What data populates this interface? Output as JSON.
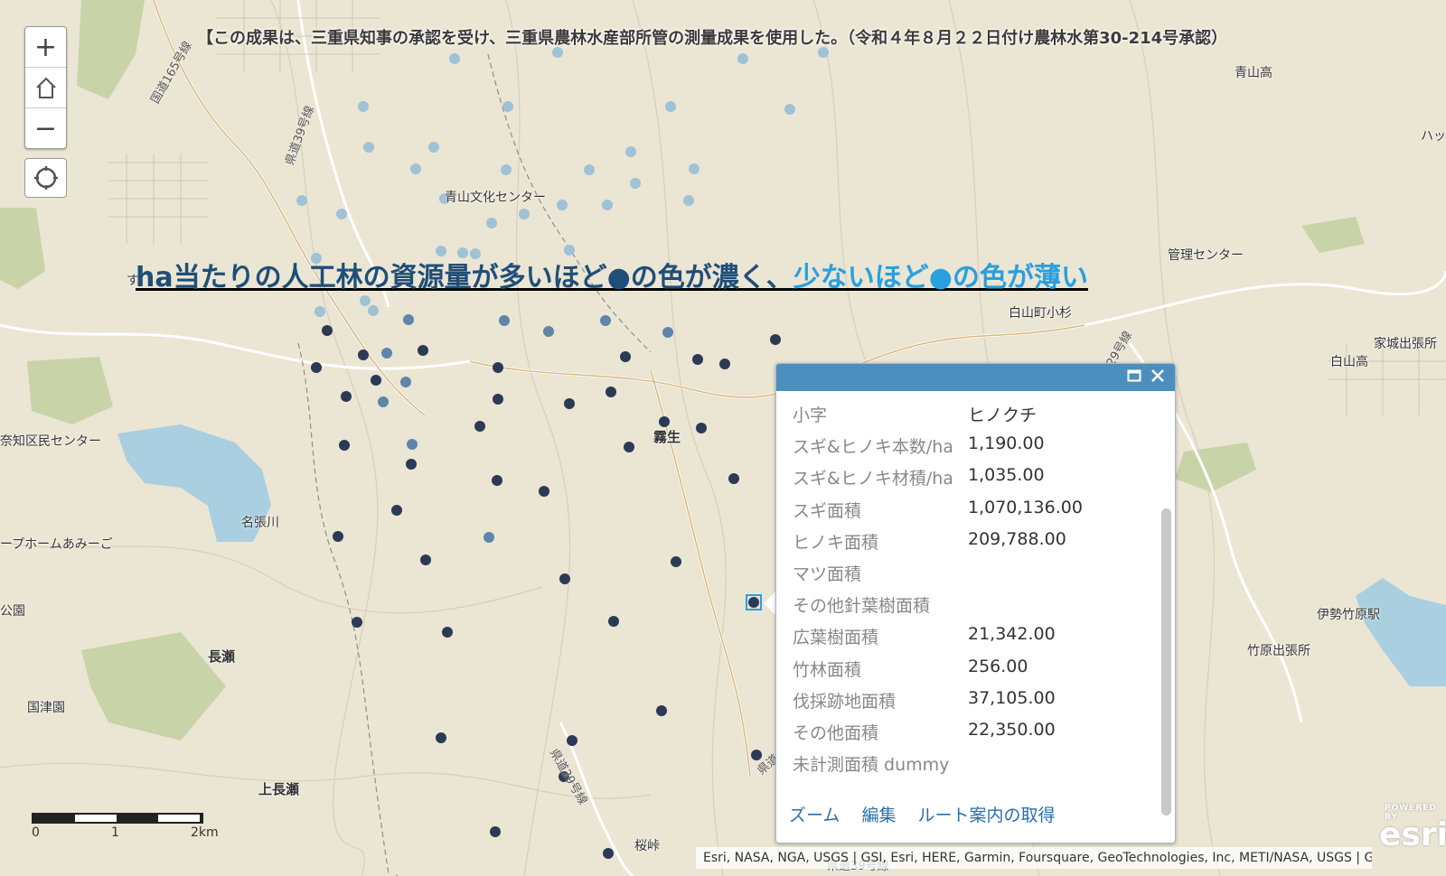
{
  "map": {
    "notice": "【この成果は、三重県知事の承認を受け、三重県農林水産部所管の測量成果を使用した。（令和４年８月２２日付け農林水第30-214号承認）",
    "legend_dark": "ha当たりの人工林の資源量が多いほど●の色が濃く、",
    "legend_light": "少ないほど●の色が薄い",
    "places": {
      "aoyama_bunka": "青山文化センター",
      "aoyama_ko": "青山高",
      "kanri": "管理センター",
      "hakusan_kosugi": "白山町小杉",
      "hakusan_ko": "白山高",
      "iejo": "家城出張所",
      "kiryu": "霧生",
      "nabarigawa": "名張川",
      "nagase": "長瀬",
      "kamisugi_cut": "上長瀬",
      "kokutsu": "国津園",
      "nachi_center": "奈知区民センター",
      "home": "ープホームあみーご",
      "ko_en": "公園",
      "ise_takehara": "伊勢竹原駅",
      "takehara_shutcho": "竹原出張所",
      "hatchi": "ハッ",
      "sakuratoge": "桜峠",
      "su": "す",
      "kami": "霧生"
    },
    "roads": {
      "r165": "国道165号線",
      "r39a": "県道39号線",
      "r39b": "県道39号線",
      "r39c": "県道",
      "r29": "29号線",
      "r39d": "県道39号線"
    },
    "scale_labels": [
      "0",
      "1",
      "2km"
    ],
    "attribution": "Esri, NASA, NGA, USGS | GSI, Esri, HERE, Garmin, Foursquare, GeoTechnologies, Inc, METI/NASA, USGS | G...",
    "esri_powered": "POWERED BY",
    "esri_logo": "esri"
  },
  "controls": {
    "zoom_in": "+",
    "zoom_out": "−"
  },
  "popup": {
    "rows": [
      {
        "key": "小字",
        "value": "ヒノクチ"
      },
      {
        "key": "スギ&ヒノキ本数/ha",
        "value": "1,190.00"
      },
      {
        "key": "スギ&ヒノキ材積/ha",
        "value": "1,035.00"
      },
      {
        "key": "スギ面積",
        "value": "1,070,136.00"
      },
      {
        "key": "ヒノキ面積",
        "value": "209,788.00"
      },
      {
        "key": "マツ面積",
        "value": ""
      },
      {
        "key": "その他針葉樹面積",
        "value": ""
      },
      {
        "key": "広葉樹面積",
        "value": "21,342.00"
      },
      {
        "key": "竹林面積",
        "value": "256.00"
      },
      {
        "key": "伐採跡地面積",
        "value": "37,105.00"
      },
      {
        "key": "その他面積",
        "value": "22,350.00"
      },
      {
        "key": "未計測面積 dummy",
        "value": ""
      }
    ],
    "actions": {
      "zoom": "ズーム",
      "edit": "編集",
      "route": "ルート案内の取得"
    }
  },
  "colors": {
    "dark_dot": "#2b3a55",
    "mid_dot": "#5f86a8",
    "light_dot": "#9fc2d6",
    "accent": "#4c8fbf"
  }
}
